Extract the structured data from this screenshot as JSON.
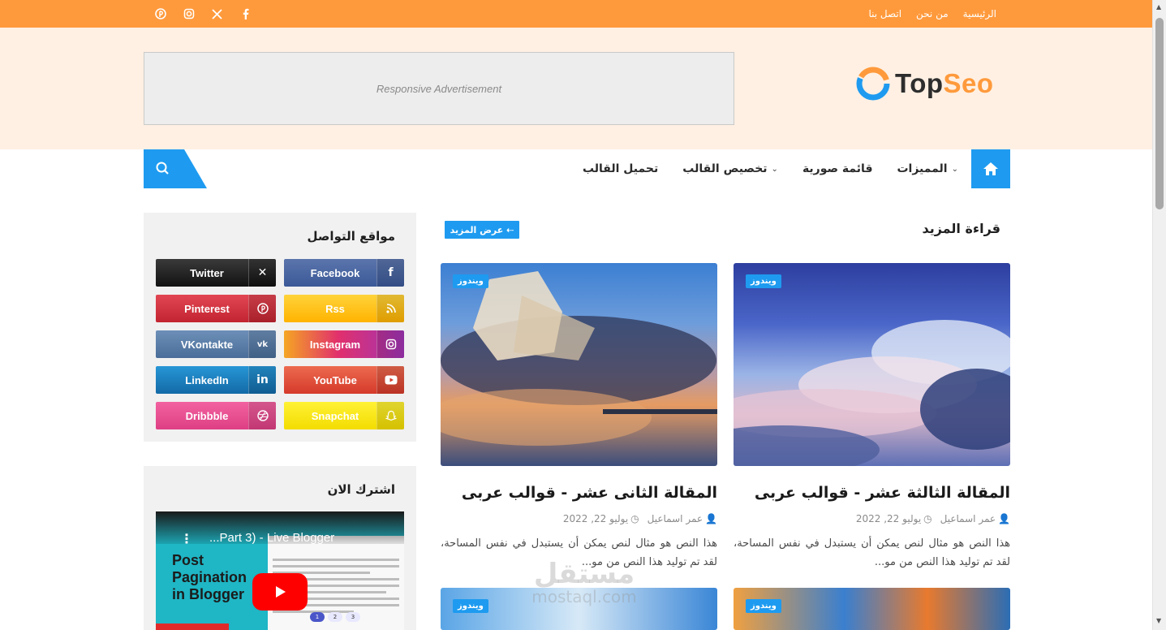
{
  "topbar": {
    "nav": [
      "الرئيسية",
      "من نحن",
      "اتصل بنا"
    ],
    "social_icons": [
      "facebook-icon",
      "x-icon",
      "instagram-icon",
      "pinterest-icon"
    ],
    "color": "#ff9a3c"
  },
  "header": {
    "logo": {
      "part1": "Top",
      "part2": "Seo"
    },
    "ad_text": "Responsive Advertisement"
  },
  "nav": {
    "items": [
      "المميزات",
      "قائمة صورية",
      "تخصيص القالب",
      "تحميل القالب"
    ],
    "accent": "#1e9bf0"
  },
  "sidebar": {
    "social_title": "مواقع التواصل",
    "social_buttons": [
      {
        "label": "Facebook",
        "icon": "f",
        "color": "#3b5998"
      },
      {
        "label": "Twitter",
        "icon": "𝕏",
        "color": "#1a1a1a"
      },
      {
        "label": "Rss",
        "icon": "◠",
        "color": "#ffc107"
      },
      {
        "label": "Pinterest",
        "icon": "℗",
        "color": "#d32f3a"
      },
      {
        "label": "Instagram",
        "icon": "◎",
        "color": "#c7367a"
      },
      {
        "label": "VKontakte",
        "icon": "vk",
        "color": "#4f76a3"
      },
      {
        "label": "YouTube",
        "icon": "▶",
        "color": "#e24a32"
      },
      {
        "label": "LinkedIn",
        "icon": "in",
        "color": "#1c84c6"
      },
      {
        "label": "Snapchat",
        "icon": "☺",
        "color": "#f7e300"
      },
      {
        "label": "Dribbble",
        "icon": "⊛",
        "color": "#ea4c89"
      }
    ],
    "subscribe_title": "اشترك الان",
    "video": {
      "title": "...Part 3) - Live Blogger",
      "text": "Post Pagination in Blogger",
      "pager": [
        "1",
        "2",
        "3"
      ]
    }
  },
  "main": {
    "section_title": "قراءة المزيد",
    "more_button": "عرض المزيد ⇠",
    "posts": [
      {
        "tag": "ويندوز",
        "title": "المقالة الثالثة عشر - قوالب عربى",
        "author": "عمر اسماعيل",
        "date": "يوليو 22, 2022",
        "excerpt": "هذا النص هو مثال لنص يمكن أن يستبدل في نفس المساحة، لقد تم توليد هذا النص من مو..."
      },
      {
        "tag": "ويندوز",
        "title": "المقالة الثانى عشر - قوالب عربى",
        "author": "عمر اسماعيل",
        "date": "يوليو 22, 2022",
        "excerpt": "هذا النص هو مثال لنص يمكن أن يستبدل في نفس المساحة، لقد تم توليد هذا النص من مو..."
      },
      {
        "tag": "ويندوز"
      },
      {
        "tag": "ويندوز"
      }
    ]
  },
  "watermark": {
    "line1": "مستقل",
    "line2": "mostaql.com"
  }
}
